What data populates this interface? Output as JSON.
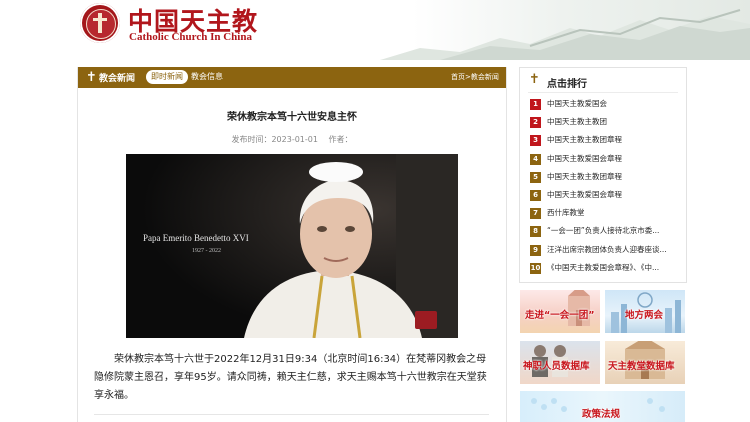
{
  "header": {
    "logo_cn": "中国天主教",
    "logo_en": "Catholic Church In China"
  },
  "main": {
    "section_title": "教会新闻",
    "tabs": [
      {
        "label": "即时新闻",
        "active": true
      },
      {
        "label": "教会信息",
        "active": false
      }
    ],
    "breadcrumb": [
      "首页",
      "教会新闻"
    ],
    "breadcrumb_sep": ">",
    "article": {
      "title": "荣休教宗本笃十六世安息主怀",
      "publish_label": "发布时间：",
      "publish_date": "2023-01-01",
      "author_label": "作者：",
      "photo_caption_line1": "Papa Emerito Benedetto XVI",
      "photo_caption_line2": "1927 - 2022",
      "body": "荣休教宗本笃十六世于2022年12月31日9:34（北京时间16:34）在梵蒂冈教会之母隐修院蒙主恩召，享年95岁。请众同祷，赖天主仁慈，求天主赐本笃十六世教宗在天堂获享永福。"
    }
  },
  "sidebar": {
    "ranking_title": "点击排行",
    "ranking": [
      {
        "num": "1",
        "text": "中国天主教爱国会",
        "color": "#c0161c"
      },
      {
        "num": "2",
        "text": "中国天主教主教团",
        "color": "#c0161c"
      },
      {
        "num": "3",
        "text": "中国天主教主教团章程",
        "color": "#c0161c"
      },
      {
        "num": "4",
        "text": "中国天主教爱国会章程",
        "color": "#8c6410"
      },
      {
        "num": "5",
        "text": "中国天主教主教团章程",
        "color": "#8c6410"
      },
      {
        "num": "6",
        "text": "中国天主教爱国会章程",
        "color": "#8c6410"
      },
      {
        "num": "7",
        "text": "西什库教堂",
        "color": "#8c6410"
      },
      {
        "num": "8",
        "text": "“一会一团”负责人接待北京市委...",
        "color": "#8c6410"
      },
      {
        "num": "9",
        "text": "汪洋出席宗教团体负责人迎春座谈...",
        "color": "#8c6410"
      },
      {
        "num": "10",
        "text": "《中国天主教爱国会章程》、《中...",
        "color": "#8c6410"
      }
    ],
    "banners": [
      {
        "label": "走进“一会一团”"
      },
      {
        "label": "地方两会"
      },
      {
        "label": "神职人员数据库"
      },
      {
        "label": "天主教堂数据库"
      },
      {
        "label": "政策法规"
      }
    ]
  },
  "colors": {
    "brand_red": "#b1161c",
    "bar_gold": "#8c6410"
  }
}
